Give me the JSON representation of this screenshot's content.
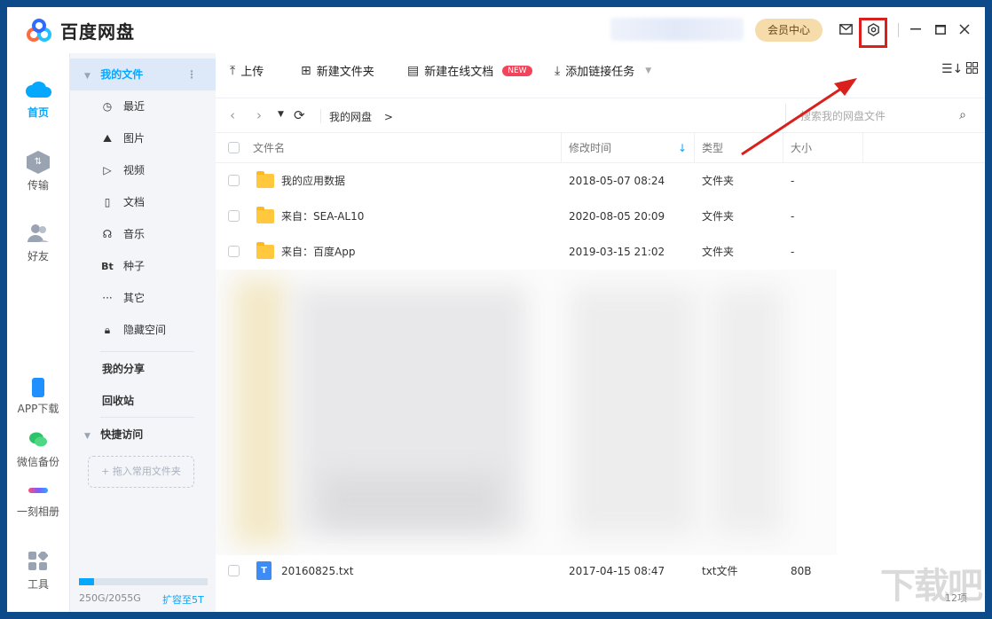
{
  "app": {
    "title": "百度网盘"
  },
  "titlebar": {
    "vip_label": "会员中心"
  },
  "leftnav": {
    "items": [
      {
        "label": "首页"
      },
      {
        "label": "传输"
      },
      {
        "label": "好友"
      },
      {
        "label": "APP下载"
      },
      {
        "label": "微信备份"
      },
      {
        "label": "一刻相册"
      },
      {
        "label": "工具"
      }
    ]
  },
  "sidebar": {
    "my_files": "我的文件",
    "sub_items": [
      {
        "label": "最近",
        "icon": "clock-icon"
      },
      {
        "label": "图片",
        "icon": "image-icon"
      },
      {
        "label": "视频",
        "icon": "video-icon"
      },
      {
        "label": "文档",
        "icon": "document-icon"
      },
      {
        "label": "音乐",
        "icon": "music-icon"
      },
      {
        "label": "种子",
        "icon": "bt-icon"
      },
      {
        "label": "其它",
        "icon": "more-icon"
      },
      {
        "label": "隐藏空间",
        "icon": "lock-icon"
      }
    ],
    "my_share": "我的分享",
    "recycle": "回收站",
    "quick_access": "快捷访问",
    "drop_hint": "+ 拖入常用文件夹",
    "storage_text": "250G/2055G",
    "expand_label": "扩容至5T",
    "storage_used_fraction": 0.12
  },
  "toolbar": {
    "upload": "上传",
    "new_folder": "新建文件夹",
    "new_online_doc": "新建在线文档",
    "new_badge": "NEW",
    "add_link_task": "添加链接任务"
  },
  "navbar": {
    "breadcrumb": "我的网盘",
    "breadcrumb_sep": ">",
    "search_placeholder": "搜索我的网盘文件"
  },
  "table": {
    "headers": {
      "name": "文件名",
      "modified": "修改时间",
      "type": "类型",
      "size": "大小"
    },
    "rows": [
      {
        "name": "我的应用数据",
        "modified": "2018-05-07 08:24",
        "type": "文件夹",
        "size": "-"
      },
      {
        "name": "来自：SEA-AL10",
        "modified": "2020-08-05 20:09",
        "type": "文件夹",
        "size": "-"
      },
      {
        "name": "来自：百度App",
        "modified": "2019-03-15 21:02",
        "type": "文件夹",
        "size": "-"
      }
    ],
    "last_row": {
      "name": "20160825.txt",
      "modified": "2017-04-15 08:47",
      "type": "txt文件",
      "size": "80B",
      "icon_letter": "T"
    },
    "item_count": "12项"
  },
  "watermark": "下载吧",
  "colors": {
    "accent": "#06a7ff",
    "highlight": "#d9201d"
  }
}
